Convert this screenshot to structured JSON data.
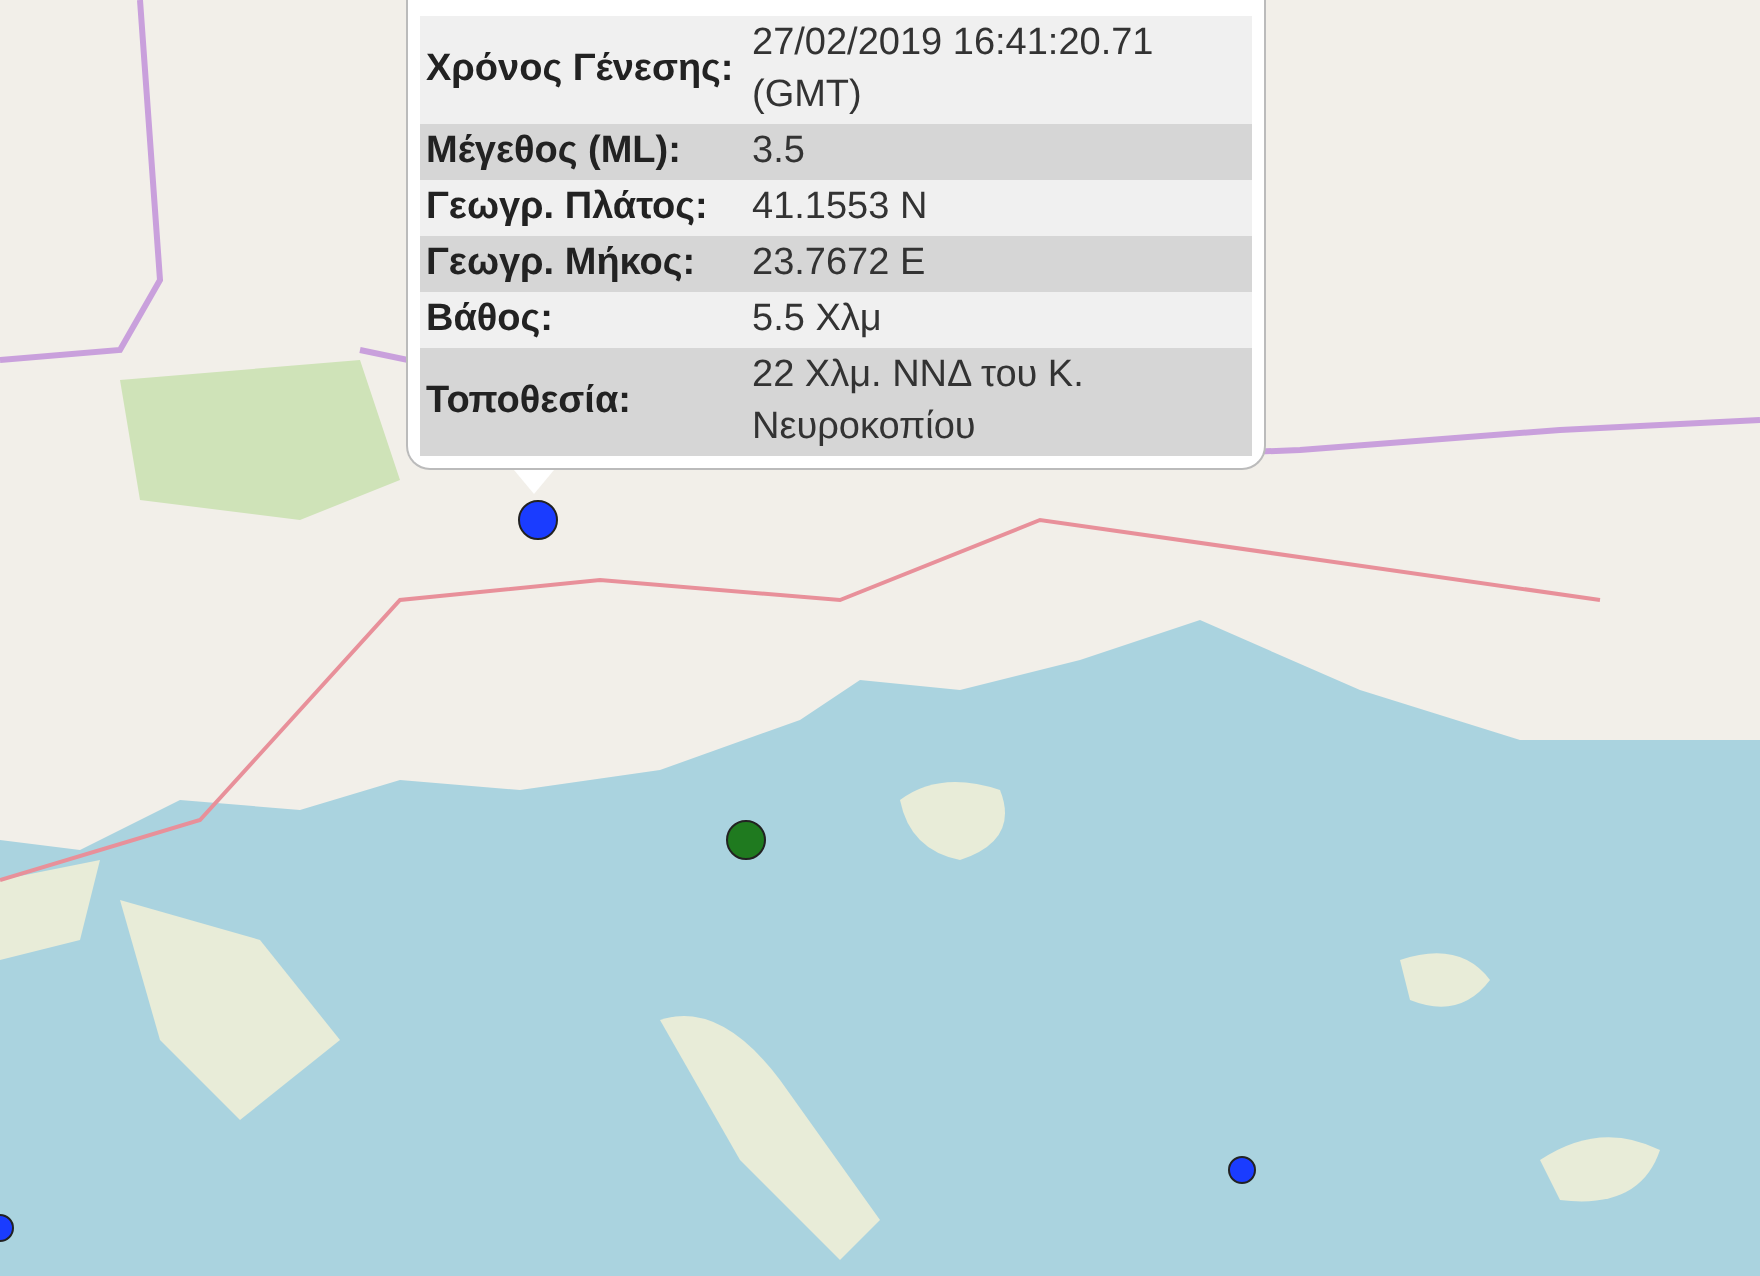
{
  "popup": {
    "rows": [
      {
        "label": "Χρόνος Γένεσης:",
        "value": "27/02/2019 16:41:20.71 (GMT)"
      },
      {
        "label": "Μέγεθος (ML):",
        "value": "3.5"
      },
      {
        "label": "Γεωγρ. Πλάτος:",
        "value": "41.1553 N"
      },
      {
        "label": "Γεωγρ. Μήκος:",
        "value": "23.7672 E"
      },
      {
        "label": "Βάθος:",
        "value": "5.5 Χλμ"
      },
      {
        "label": "Τοποθεσία:",
        "value": "22 Χλμ. ΝΝΔ του Κ. Νευροκοπίου"
      }
    ]
  },
  "markers": [
    {
      "kind": "large",
      "color": "#1a3cff"
    },
    {
      "kind": "large",
      "color": "#1f7a1f"
    },
    {
      "kind": "small",
      "color": "#1a3cff"
    },
    {
      "kind": "small",
      "color": "#1a3cff"
    }
  ]
}
